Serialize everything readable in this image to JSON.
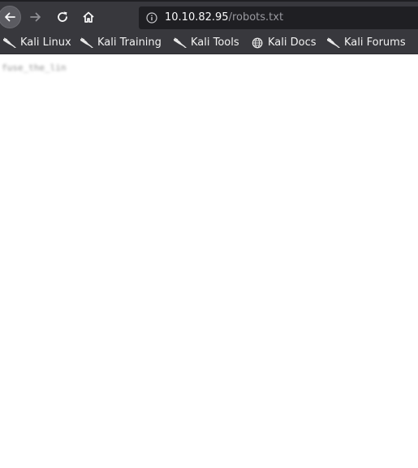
{
  "toolbar": {
    "buttons": [
      {
        "name": "back",
        "icon": "back-arrow-icon"
      },
      {
        "name": "forward",
        "icon": "forward-arrow-icon"
      },
      {
        "name": "reload",
        "icon": "reload-icon"
      },
      {
        "name": "home",
        "icon": "home-icon"
      }
    ],
    "url": {
      "icon": "info-icon",
      "host": "10.10.82.95",
      "path": "/robots.txt"
    }
  },
  "bookmarks": [
    {
      "label": "Kali Linux",
      "icon": "kali-dragon-icon"
    },
    {
      "label": "Kali Training",
      "icon": "kali-dragon-icon"
    },
    {
      "label": "Kali Tools",
      "icon": "kali-dragon-icon"
    },
    {
      "label": "Kali Docs",
      "icon": "globe-icon"
    },
    {
      "label": "Kali Forums",
      "icon": "kali-dragon-icon"
    }
  ],
  "page": {
    "content": "fuse_the_lin"
  },
  "colors": {
    "toolbar_bg": "#38383d",
    "urlbar_bg": "#1f1f23",
    "url_host": "#f9f9fa",
    "url_path": "#9a9aa0",
    "page_bg": "#ffffff"
  }
}
